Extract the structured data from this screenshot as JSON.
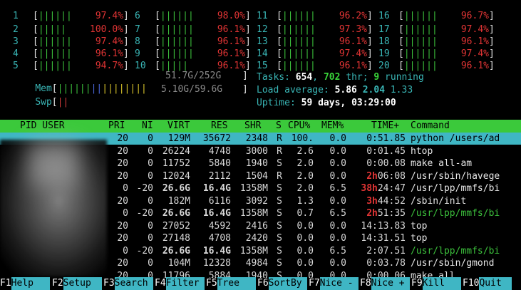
{
  "cpus": [
    {
      "n": "1",
      "bar": "||||||",
      "pct": "97.4%"
    },
    {
      "n": "2",
      "bar": "|||||",
      "pct": "100.0%"
    },
    {
      "n": "3",
      "bar": "||||||",
      "pct": "97.4%"
    },
    {
      "n": "4",
      "bar": "||||||",
      "pct": "96.1%"
    },
    {
      "n": "5",
      "bar": "||||||",
      "pct": "94.7%"
    },
    {
      "n": "6",
      "bar": "||||||",
      "pct": "98.0%"
    },
    {
      "n": "7",
      "bar": "||||||",
      "pct": "96.1%"
    },
    {
      "n": "8",
      "bar": "||||||",
      "pct": "96.1%"
    },
    {
      "n": "9",
      "bar": "||||||",
      "pct": "96.1%"
    },
    {
      "n": "10",
      "bar": "|||||",
      "pct": "96.1%"
    },
    {
      "n": "11",
      "bar": "||||||",
      "pct": "96.2%"
    },
    {
      "n": "12",
      "bar": "||||||",
      "pct": "97.3%"
    },
    {
      "n": "13",
      "bar": "||||||",
      "pct": "96.1%"
    },
    {
      "n": "14",
      "bar": "||||||",
      "pct": "97.4%"
    },
    {
      "n": "15",
      "bar": "||||||",
      "pct": "96.1%"
    },
    {
      "n": "16",
      "bar": "||||||",
      "pct": "96.7%"
    },
    {
      "n": "17",
      "bar": "||||||",
      "pct": "97.4%"
    },
    {
      "n": "18",
      "bar": "||||||",
      "pct": "96.1%"
    },
    {
      "n": "19",
      "bar": "||||||",
      "pct": "97.4%"
    },
    {
      "n": "20",
      "bar": "||||||",
      "pct": "96.1%"
    }
  ],
  "mem": {
    "label": "Mem",
    "value": "51.7G/252G"
  },
  "swp": {
    "label": "Swp",
    "value": "5.10G/59.6G"
  },
  "tasks": {
    "label": "Tasks:",
    "count": "654",
    "thr": "702",
    "thr_label": "thr;",
    "running": "9",
    "running_label": "running"
  },
  "load": {
    "label": "Load average:",
    "l1": "5.86",
    "l5": "2.04",
    "l15": "1.33"
  },
  "uptime": {
    "label": "Uptime:",
    "value": "59 days, 03:29:00"
  },
  "header": {
    "pid_user": "PID USER",
    "pri": "PRI",
    "ni": "NI",
    "virt": "VIRT",
    "res": "RES",
    "shr": "SHR",
    "s": "S",
    "cpu": "CPU%",
    "mem": "MEM%",
    "time": "TIME+",
    "command": "Command"
  },
  "processes": [
    {
      "pri": "20",
      "ni": "0",
      "virt": "129M",
      "res": "35672",
      "shr": "2348",
      "s": "R",
      "cpu": "100.",
      "mem": "0.0",
      "time": "0:51.85",
      "cmd": "python /users/ad"
    },
    {
      "pri": "20",
      "ni": "0",
      "virt": "26224",
      "res": "4748",
      "shr": "3000",
      "s": "R",
      "cpu": "2.6",
      "mem": "0.0",
      "time": "0:01.45",
      "cmd": "htop"
    },
    {
      "pri": "20",
      "ni": "0",
      "virt": "11752",
      "res": "5840",
      "shr": "1940",
      "s": "S",
      "cpu": "2.0",
      "mem": "0.0",
      "time": "0:00.08",
      "cmd": "make all-am"
    },
    {
      "pri": "20",
      "ni": "0",
      "virt": "12024",
      "res": "2112",
      "shr": "1504",
      "s": "R",
      "cpu": "2.0",
      "mem": "0.0",
      "time": "2h06:08",
      "cmd": "/usr/sbin/havege"
    },
    {
      "pri": "0",
      "ni": "-20",
      "virt": "26.6G",
      "res": "16.4G",
      "shr": "1358M",
      "s": "S",
      "cpu": "2.0",
      "mem": "6.5",
      "time": "38h24:47",
      "cmd": "/usr/lpp/mmfs/bi"
    },
    {
      "pri": "20",
      "ni": "0",
      "virt": "182M",
      "res": "6116",
      "shr": "3092",
      "s": "S",
      "cpu": "1.3",
      "mem": "0.0",
      "time": "3h44:52",
      "cmd": "/sbin/init"
    },
    {
      "pri": "0",
      "ni": "-20",
      "virt": "26.6G",
      "res": "16.4G",
      "shr": "1358M",
      "s": "S",
      "cpu": "0.7",
      "mem": "6.5",
      "time": "2h51:35",
      "cmd": "/usr/lpp/mmfs/bi"
    },
    {
      "pri": "20",
      "ni": "0",
      "virt": "27052",
      "res": "4592",
      "shr": "2416",
      "s": "S",
      "cpu": "0.0",
      "mem": "0.0",
      "time": "14:13.83",
      "cmd": "top"
    },
    {
      "pri": "20",
      "ni": "0",
      "virt": "27148",
      "res": "4708",
      "shr": "2420",
      "s": "S",
      "cpu": "0.0",
      "mem": "0.0",
      "time": "14:31.51",
      "cmd": "top"
    },
    {
      "pri": "0",
      "ni": "-20",
      "virt": "26.6G",
      "res": "16.4G",
      "shr": "1358M",
      "s": "S",
      "cpu": "0.0",
      "mem": "6.5",
      "time": "2:07.51",
      "cmd": "/usr/lpp/mmfs/bi"
    },
    {
      "pri": "20",
      "ni": "0",
      "virt": "104M",
      "res": "12328",
      "shr": "4984",
      "s": "S",
      "cpu": "0.0",
      "mem": "0.0",
      "time": "0:03.78",
      "cmd": "/usr/sbin/gmond"
    },
    {
      "pri": "20",
      "ni": "0",
      "virt": "11796",
      "res": "5884",
      "shr": "1940",
      "s": "S",
      "cpu": "0.0",
      "mem": "0.0",
      "time": "0:00.06",
      "cmd": "make all"
    }
  ],
  "footer": [
    {
      "key": "F1",
      "label": "Help"
    },
    {
      "key": "F2",
      "label": "Setup"
    },
    {
      "key": "F3",
      "label": "Search"
    },
    {
      "key": "F4",
      "label": "Filter"
    },
    {
      "key": "F5",
      "label": "Tree"
    },
    {
      "key": "F6",
      "label": "SortBy"
    },
    {
      "key": "F7",
      "label": "Nice -"
    },
    {
      "key": "F8",
      "label": "Nice +"
    },
    {
      "key": "F9",
      "label": "Kill"
    },
    {
      "key": "F10",
      "label": "Quit"
    }
  ]
}
